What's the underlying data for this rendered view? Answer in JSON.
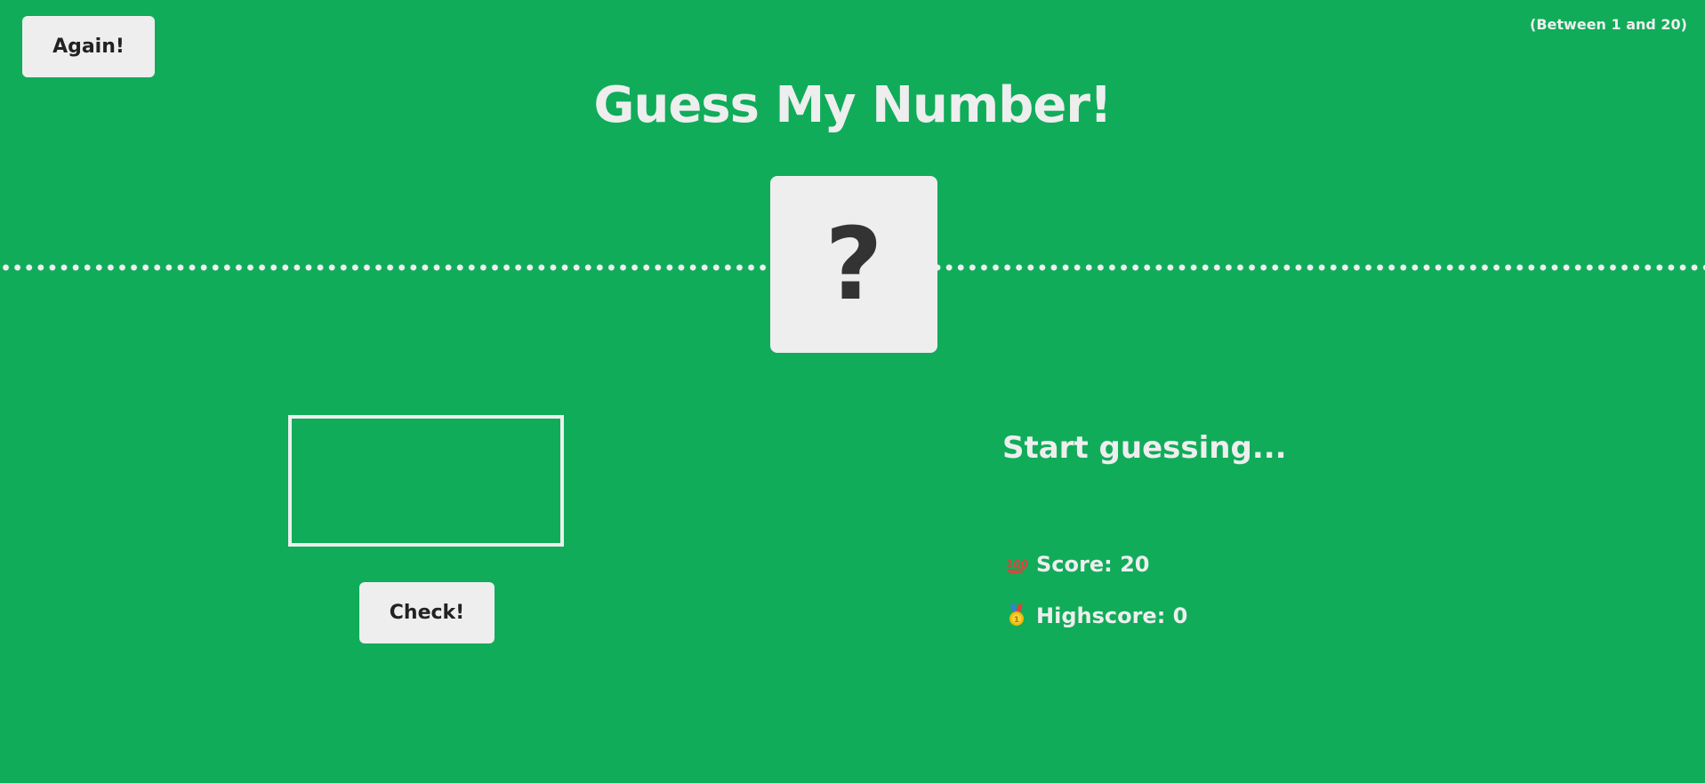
{
  "header": {
    "again_label": "Again!",
    "range_hint": "(Between 1 and 20)",
    "title": "Guess My Number!"
  },
  "secret": {
    "display": "?"
  },
  "guess": {
    "value": "",
    "placeholder": ""
  },
  "actions": {
    "check_label": "Check!"
  },
  "status": {
    "message": "Start guessing...",
    "score_label": "Score: 20",
    "highscore_label": "Highscore: 0",
    "score_icon": "hundred-points-icon",
    "highscore_icon": "medal-icon"
  },
  "colors": {
    "background": "#10ac5a",
    "foreground": "#eeeeee",
    "button_text": "#222222",
    "secret_text": "#333333"
  }
}
